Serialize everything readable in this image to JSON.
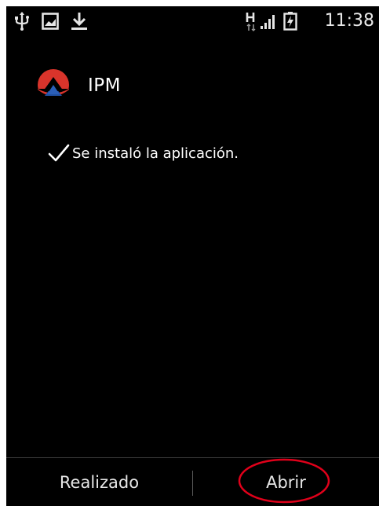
{
  "status_bar": {
    "time": "11:38",
    "left_icons": [
      "usb-icon",
      "image-notification-icon",
      "download-icon"
    ],
    "right_icons": [
      "network-h-icon",
      "signal-icon",
      "battery-icon"
    ]
  },
  "app": {
    "name": "IPM",
    "icon": "ipm-logo-icon"
  },
  "message": {
    "icon": "checkmark-icon",
    "text": "Se instaló la aplicación."
  },
  "buttons": {
    "done_label": "Realizado",
    "open_label": "Abrir"
  },
  "colors": {
    "background": "#000000",
    "logo_red": "#d9342b",
    "logo_blue": "#1f4fa0",
    "highlight": "#e0001a"
  }
}
